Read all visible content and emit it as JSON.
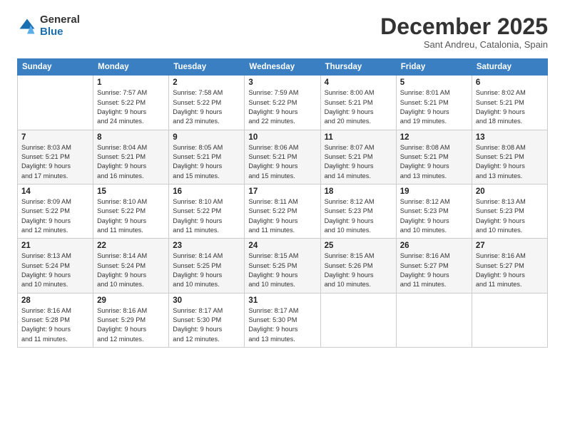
{
  "logo": {
    "general": "General",
    "blue": "Blue"
  },
  "header": {
    "title": "December 2025",
    "subtitle": "Sant Andreu, Catalonia, Spain"
  },
  "weekdays": [
    "Sunday",
    "Monday",
    "Tuesday",
    "Wednesday",
    "Thursday",
    "Friday",
    "Saturday"
  ],
  "weeks": [
    [
      {
        "num": "",
        "info": ""
      },
      {
        "num": "1",
        "info": "Sunrise: 7:57 AM\nSunset: 5:22 PM\nDaylight: 9 hours\nand 24 minutes."
      },
      {
        "num": "2",
        "info": "Sunrise: 7:58 AM\nSunset: 5:22 PM\nDaylight: 9 hours\nand 23 minutes."
      },
      {
        "num": "3",
        "info": "Sunrise: 7:59 AM\nSunset: 5:22 PM\nDaylight: 9 hours\nand 22 minutes."
      },
      {
        "num": "4",
        "info": "Sunrise: 8:00 AM\nSunset: 5:21 PM\nDaylight: 9 hours\nand 20 minutes."
      },
      {
        "num": "5",
        "info": "Sunrise: 8:01 AM\nSunset: 5:21 PM\nDaylight: 9 hours\nand 19 minutes."
      },
      {
        "num": "6",
        "info": "Sunrise: 8:02 AM\nSunset: 5:21 PM\nDaylight: 9 hours\nand 18 minutes."
      }
    ],
    [
      {
        "num": "7",
        "info": "Sunrise: 8:03 AM\nSunset: 5:21 PM\nDaylight: 9 hours\nand 17 minutes."
      },
      {
        "num": "8",
        "info": "Sunrise: 8:04 AM\nSunset: 5:21 PM\nDaylight: 9 hours\nand 16 minutes."
      },
      {
        "num": "9",
        "info": "Sunrise: 8:05 AM\nSunset: 5:21 PM\nDaylight: 9 hours\nand 15 minutes."
      },
      {
        "num": "10",
        "info": "Sunrise: 8:06 AM\nSunset: 5:21 PM\nDaylight: 9 hours\nand 15 minutes."
      },
      {
        "num": "11",
        "info": "Sunrise: 8:07 AM\nSunset: 5:21 PM\nDaylight: 9 hours\nand 14 minutes."
      },
      {
        "num": "12",
        "info": "Sunrise: 8:08 AM\nSunset: 5:21 PM\nDaylight: 9 hours\nand 13 minutes."
      },
      {
        "num": "13",
        "info": "Sunrise: 8:08 AM\nSunset: 5:21 PM\nDaylight: 9 hours\nand 13 minutes."
      }
    ],
    [
      {
        "num": "14",
        "info": "Sunrise: 8:09 AM\nSunset: 5:22 PM\nDaylight: 9 hours\nand 12 minutes."
      },
      {
        "num": "15",
        "info": "Sunrise: 8:10 AM\nSunset: 5:22 PM\nDaylight: 9 hours\nand 11 minutes."
      },
      {
        "num": "16",
        "info": "Sunrise: 8:10 AM\nSunset: 5:22 PM\nDaylight: 9 hours\nand 11 minutes."
      },
      {
        "num": "17",
        "info": "Sunrise: 8:11 AM\nSunset: 5:22 PM\nDaylight: 9 hours\nand 11 minutes."
      },
      {
        "num": "18",
        "info": "Sunrise: 8:12 AM\nSunset: 5:23 PM\nDaylight: 9 hours\nand 10 minutes."
      },
      {
        "num": "19",
        "info": "Sunrise: 8:12 AM\nSunset: 5:23 PM\nDaylight: 9 hours\nand 10 minutes."
      },
      {
        "num": "20",
        "info": "Sunrise: 8:13 AM\nSunset: 5:23 PM\nDaylight: 9 hours\nand 10 minutes."
      }
    ],
    [
      {
        "num": "21",
        "info": "Sunrise: 8:13 AM\nSunset: 5:24 PM\nDaylight: 9 hours\nand 10 minutes."
      },
      {
        "num": "22",
        "info": "Sunrise: 8:14 AM\nSunset: 5:24 PM\nDaylight: 9 hours\nand 10 minutes."
      },
      {
        "num": "23",
        "info": "Sunrise: 8:14 AM\nSunset: 5:25 PM\nDaylight: 9 hours\nand 10 minutes."
      },
      {
        "num": "24",
        "info": "Sunrise: 8:15 AM\nSunset: 5:25 PM\nDaylight: 9 hours\nand 10 minutes."
      },
      {
        "num": "25",
        "info": "Sunrise: 8:15 AM\nSunset: 5:26 PM\nDaylight: 9 hours\nand 10 minutes."
      },
      {
        "num": "26",
        "info": "Sunrise: 8:16 AM\nSunset: 5:27 PM\nDaylight: 9 hours\nand 11 minutes."
      },
      {
        "num": "27",
        "info": "Sunrise: 8:16 AM\nSunset: 5:27 PM\nDaylight: 9 hours\nand 11 minutes."
      }
    ],
    [
      {
        "num": "28",
        "info": "Sunrise: 8:16 AM\nSunset: 5:28 PM\nDaylight: 9 hours\nand 11 minutes."
      },
      {
        "num": "29",
        "info": "Sunrise: 8:16 AM\nSunset: 5:29 PM\nDaylight: 9 hours\nand 12 minutes."
      },
      {
        "num": "30",
        "info": "Sunrise: 8:17 AM\nSunset: 5:30 PM\nDaylight: 9 hours\nand 12 minutes."
      },
      {
        "num": "31",
        "info": "Sunrise: 8:17 AM\nSunset: 5:30 PM\nDaylight: 9 hours\nand 13 minutes."
      },
      {
        "num": "",
        "info": ""
      },
      {
        "num": "",
        "info": ""
      },
      {
        "num": "",
        "info": ""
      }
    ]
  ]
}
